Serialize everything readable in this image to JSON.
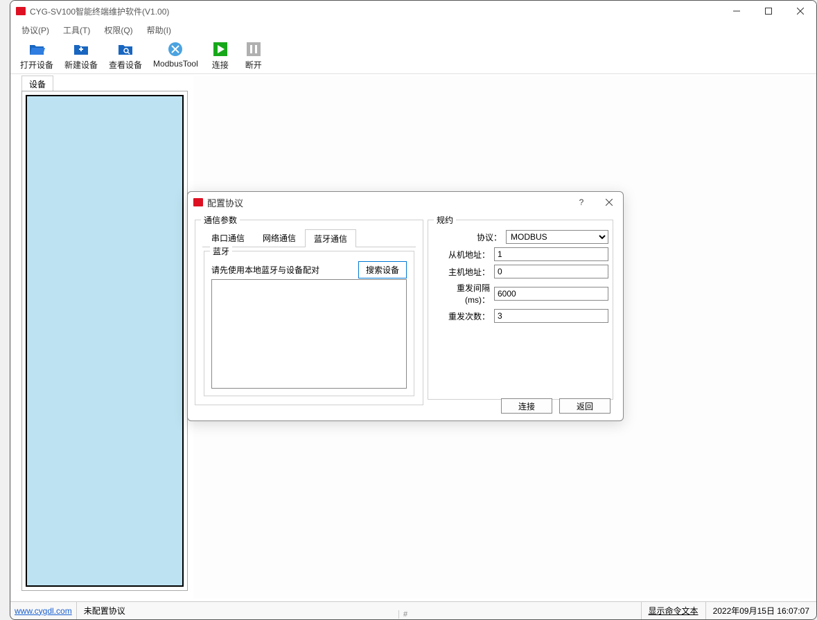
{
  "app": {
    "title": "CYG-SV100智能终端维护软件(V1.00)"
  },
  "menu": {
    "protocol": "协议(P)",
    "tools": "工具(T)",
    "permission": "权限(Q)",
    "help": "帮助(I)"
  },
  "toolbar": {
    "open": "打开设备",
    "new": "新建设备",
    "view": "查看设备",
    "modbus": "ModbusTool",
    "connect": "连接",
    "disconnect": "断开"
  },
  "panel": {
    "devices_tab": "设备"
  },
  "dialog": {
    "title": "配置协议",
    "comm_legend": "通信参数",
    "proto_legend": "规约",
    "tabs": {
      "serial": "串口通信",
      "network": "网络通信",
      "bluetooth": "蓝牙通信"
    },
    "bt_legend": "蓝牙",
    "bt_msg": "请先使用本地蓝牙与设备配对",
    "bt_search": "搜索设备",
    "proto": {
      "label_protocol": "协议：",
      "value_protocol": "MODBUS",
      "label_slave": "从机地址：",
      "value_slave": "1",
      "label_master": "主机地址：",
      "value_master": "0",
      "label_interval": "重发间隔(ms)：",
      "value_interval": "6000",
      "label_retry": "重发次数：",
      "value_retry": "3"
    },
    "btn_connect": "连接",
    "btn_back": "返回"
  },
  "status": {
    "url": "www.cygdl.com",
    "proto": "未配置协议",
    "show_cmd": "显示命令文本",
    "timestamp": "2022年09月15日 16:07:07"
  },
  "bottom_hash": "#"
}
